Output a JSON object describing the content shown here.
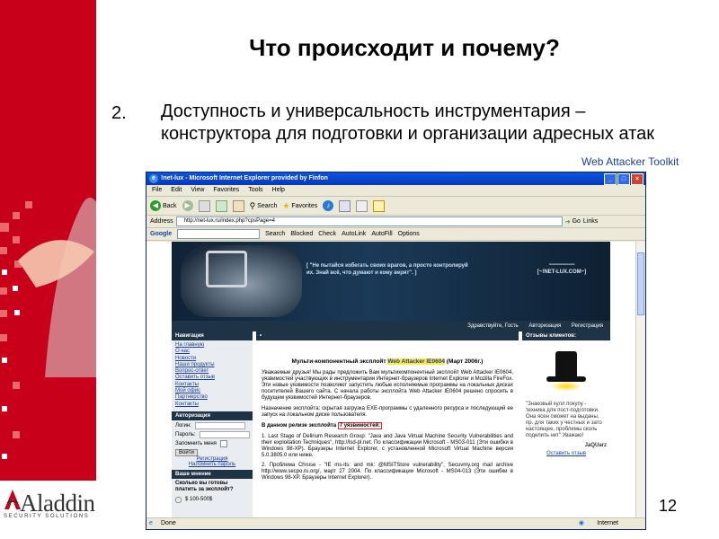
{
  "slide": {
    "title": "Что происходит и почему?",
    "item_number": "2.",
    "item_text": "Доступность и универсальность инструментария – конструктора для подготовки и организации адресных атак",
    "caption": "Web Attacker Toolkit",
    "page_number": "12",
    "logo_name": "Aladdin",
    "logo_sub": "SECURITY SOLUTIONS"
  },
  "browser": {
    "title": "!net-lux - Microsoft Internet Explorer provided by Finfon",
    "menu": [
      "File",
      "Edit",
      "View",
      "Favorites",
      "Tools",
      "Help"
    ],
    "back_label": "Back",
    "search_label": "Search",
    "favorites_label": "Favorites",
    "address_label": "Address",
    "address_value": "http://net-lux.ru/index.php?cpsPage=4",
    "go_label": "Go",
    "links_label": "Links",
    "google_label": "Google",
    "google_buttons": [
      "Search",
      "Blocked",
      "Check",
      "AutoLink",
      "AutoFill",
      "Options"
    ],
    "status_done": "Done",
    "status_zone": "Internet"
  },
  "site": {
    "banner_quote": "[ \"Не пытайся избегать своих врагов, а просто контролируй их. Знай всё, что думают и кому верят\". ]",
    "site_name_dashes": "-------------------",
    "site_name": "[~!NET-LUX.COM~]",
    "topnav": [
      "Здравствуйте, Гость",
      "Авторизация",
      "Регистрация"
    ],
    "nav_head": "Навигация",
    "nav_items": [
      "На главную",
      "О нас",
      "Новости",
      "Наши продукты",
      "Вопрос-ответ",
      "Оставить отзыв",
      "Контакты",
      "Мой офис",
      "Партнерство",
      "Контакты"
    ],
    "auth_head": "Авторизация",
    "login_label": "Логин:",
    "password_label": "Пароль:",
    "remember_label": "Запомнить меня",
    "enter_label": "Войти",
    "register_link": "Регистрация",
    "forgot_link": "Напомнить пароль",
    "poll_head": "Ваше мнение",
    "poll_text": "Сколько вы готовы платить за эксплойт?",
    "poll_option": "$ 100-500$",
    "exploit_title_pre": "Мульти-компонентный эксплойт",
    "exploit_title_hl": "Web Attacker IE0604",
    "exploit_title_post": "(Март 2006г.)",
    "para1": "Уважаемые друзья! Мы рады предложить Вам мультикомпонентный эксплойт Web Attacker IE0604, уязвимостей участвующих в инструментарии Интернет-браузеров Internet Explorer и Mozilla FireFox. Эти новые уязвимости позволяют запустить любые исполняемые программы на локальных дисках посетителей Вашего сайта. С начала работы эксплойта Web Attacker IE0604 решено спросить в будущем уязвимостей Интернет-браузеров.",
    "para2": "Назначение эксплойта: скрытая загрузка EXE-программы с удаленного ресурса и последующий ее запуск на локальном диске пользователя.",
    "para3_pre": "В данном релизе эксплойта",
    "para3_boxed": "7 уязвимостей:",
    "para4": "1. Last Stage of Delirium Research Group: \"Java and Java Virtual Machine Security Vulnerabilities and their exploitation Techniques\", http://lsd-pl.net. По классификации Microsoft - MS03-011 (Эти ошибки в Windows 98-XP). Браузеры Internet Explorer, с установленной Microsoft Virtual Machine версия 5.0.3805.0 или ниже.",
    "para5": "2. Проблема Chruse - \"IE ms-its: and mk: @MSITStore vulnerability\", Secuvmy.org mail archive http://www.secpo.ru.org/, март 27 2004. По классификации Microsoft - MS04-013 (Эти ошибки в Windows 98-XP. Браузеры Internet Explorer).",
    "right_head": "Отзывы клиентов:",
    "right_quote": "\"Знаковый кулл покупу - техника для пост-подготовки. Она ясен сможет на выданы, пр. для таких у честных и зато настоящее, проблемы сколь поделить нит\" Уважаю!",
    "right_sign": "JaQUarz",
    "right_link": "Оставить отзыв"
  }
}
